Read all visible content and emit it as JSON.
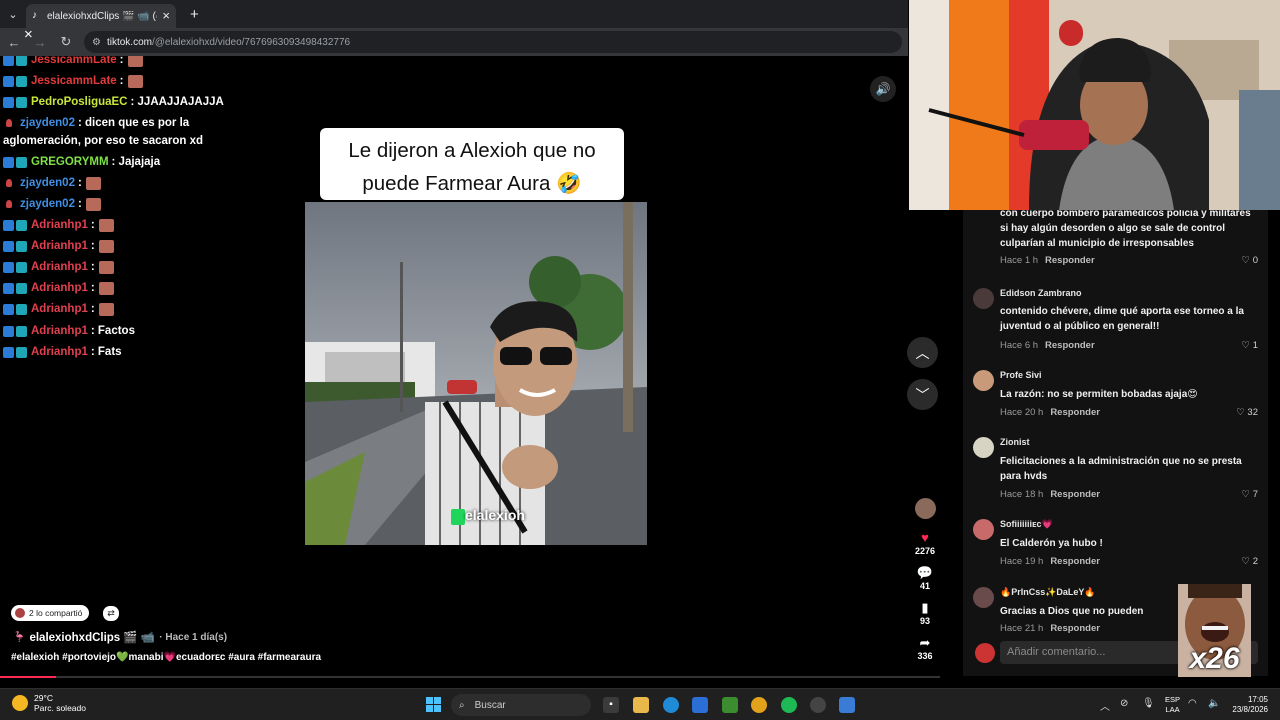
{
  "browser": {
    "tab_title": "elalexiohxdClips 🎬 📹 (@el",
    "tab_close": "×",
    "new_tab": "+",
    "url_domain": "tiktok.com",
    "url_path": "/@elalexiohxd/video/7676963093498432776"
  },
  "chat": {
    "close": "×",
    "messages": [
      {
        "user": "JessicammLate",
        "text": ":",
        "color": "#e23a3a"
      },
      {
        "user": "JessicammLate",
        "text": ":",
        "color": "#e23a3a"
      },
      {
        "user": "PedroPosliguaEC",
        "text": ": JJAAJJAJAJJA",
        "color": "#c9e73b"
      },
      {
        "user": "zjayden02",
        "text": ": dicen que es por la",
        "color": "#3f8fe4"
      },
      {
        "user": "",
        "text": "aglomeración, por eso te sacaron xd",
        "color": "#ffffff"
      },
      {
        "user": "GREGORYMM",
        "text": ": Jajajaja",
        "color": "#7fe047"
      },
      {
        "user": "zjayden02",
        "text": ":",
        "color": "#3f8fe4"
      },
      {
        "user": "zjayden02",
        "text": ":",
        "color": "#3f8fe4"
      },
      {
        "user": "Adrianhp1",
        "text": ":",
        "color": "#e0404f"
      },
      {
        "user": "Adrianhp1",
        "text": ":",
        "color": "#e0404f"
      },
      {
        "user": "Adrianhp1",
        "text": ":",
        "color": "#e0404f"
      },
      {
        "user": "Adrianhp1",
        "text": ":",
        "color": "#e0404f"
      },
      {
        "user": "Adrianhp1",
        "text": ":",
        "color": "#e0404f"
      },
      {
        "user": "Adrianhp1",
        "text": ": Factos",
        "color": "#e0404f"
      },
      {
        "user": "Adrianhp1",
        "text": ": Fats",
        "color": "#e0404f"
      }
    ]
  },
  "video": {
    "caption_line1": "Le dijeron a Alexioh que no",
    "caption_line2": "puede Farmear Aura 🤣",
    "watermark": "elalexioh",
    "progress_percent": 6
  },
  "actions": {
    "likes": "2276",
    "comments": "41",
    "saves": "93",
    "shares": "336"
  },
  "post": {
    "shared_label": "2 lo compartió",
    "author": "elalexiohxdClips 🎬 📹",
    "time_ago": "· Hace 1 día(s)",
    "hashtags": "#elalexioh #portoviejo💚manabi💗ecuadorᴇᴄ #aura #farmearaura"
  },
  "comments": [
    {
      "name": "",
      "text": "con cuerpo bombero paramédicos policía y militares si hay algún desorden o algo se sale de control culparían al municipio de irresponsables",
      "time": "Hace 1 h",
      "reply": "Responder",
      "likes": "0"
    },
    {
      "name": "Edidson Zambrano",
      "text": "contenido chévere, dime qué aporta ese torneo a la juventud o al público en general!!",
      "time": "Hace 6 h",
      "reply": "Responder",
      "likes": "1"
    },
    {
      "name": "Profe Sivi",
      "text": "La razón: no se permiten bobadas ajaja😍",
      "time": "Hace 20 h",
      "reply": "Responder",
      "likes": "32"
    },
    {
      "name": "Zionist",
      "text": "Felicitaciones a la administración que no se presta para hvds",
      "time": "Hace 18 h",
      "reply": "Responder",
      "likes": "7"
    },
    {
      "name": "Sofiiiiiiiᴇᴄ💗",
      "text": "El Calderón ya hubo !",
      "time": "Hace 19 h",
      "reply": "Responder",
      "likes": "2"
    },
    {
      "name": "🔥PrInCss✨DaLeY🔥",
      "text": "Gracias a Dios que no pueden",
      "time": "Hace 21 h",
      "reply": "Responder",
      "likes": ""
    }
  ],
  "comment_input": {
    "placeholder": "Añadir comentario..."
  },
  "overlay": {
    "multiplier": "x26"
  },
  "taskbar": {
    "temp": "29°C",
    "weather": "Parc. soleado",
    "search": "Buscar",
    "lang_top": "ESP",
    "lang_bottom": "LAA",
    "time": "17:05",
    "date": "23/8/2026"
  }
}
